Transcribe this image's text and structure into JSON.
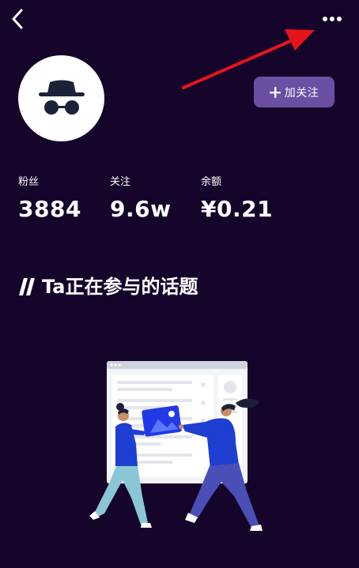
{
  "header": {
    "back_icon": "chevron-left-icon",
    "more_icon": "more-horizontal-icon"
  },
  "profile": {
    "avatar_icon": "incognito-icon",
    "follow_button": {
      "icon": "plus-icon",
      "label": "加关注"
    }
  },
  "stats": [
    {
      "label": "粉丝",
      "value": "3884"
    },
    {
      "label": "关注",
      "value": "9.6w"
    },
    {
      "label": "余额",
      "value": "¥0.21"
    }
  ],
  "topics_section": {
    "title": "Ta正在参与的话题",
    "empty_illustration": "empty-state-illustration"
  },
  "colors": {
    "background": "#16052b",
    "follow_button": "#6a4fa4",
    "annotation_arrow": "#e5141b"
  }
}
